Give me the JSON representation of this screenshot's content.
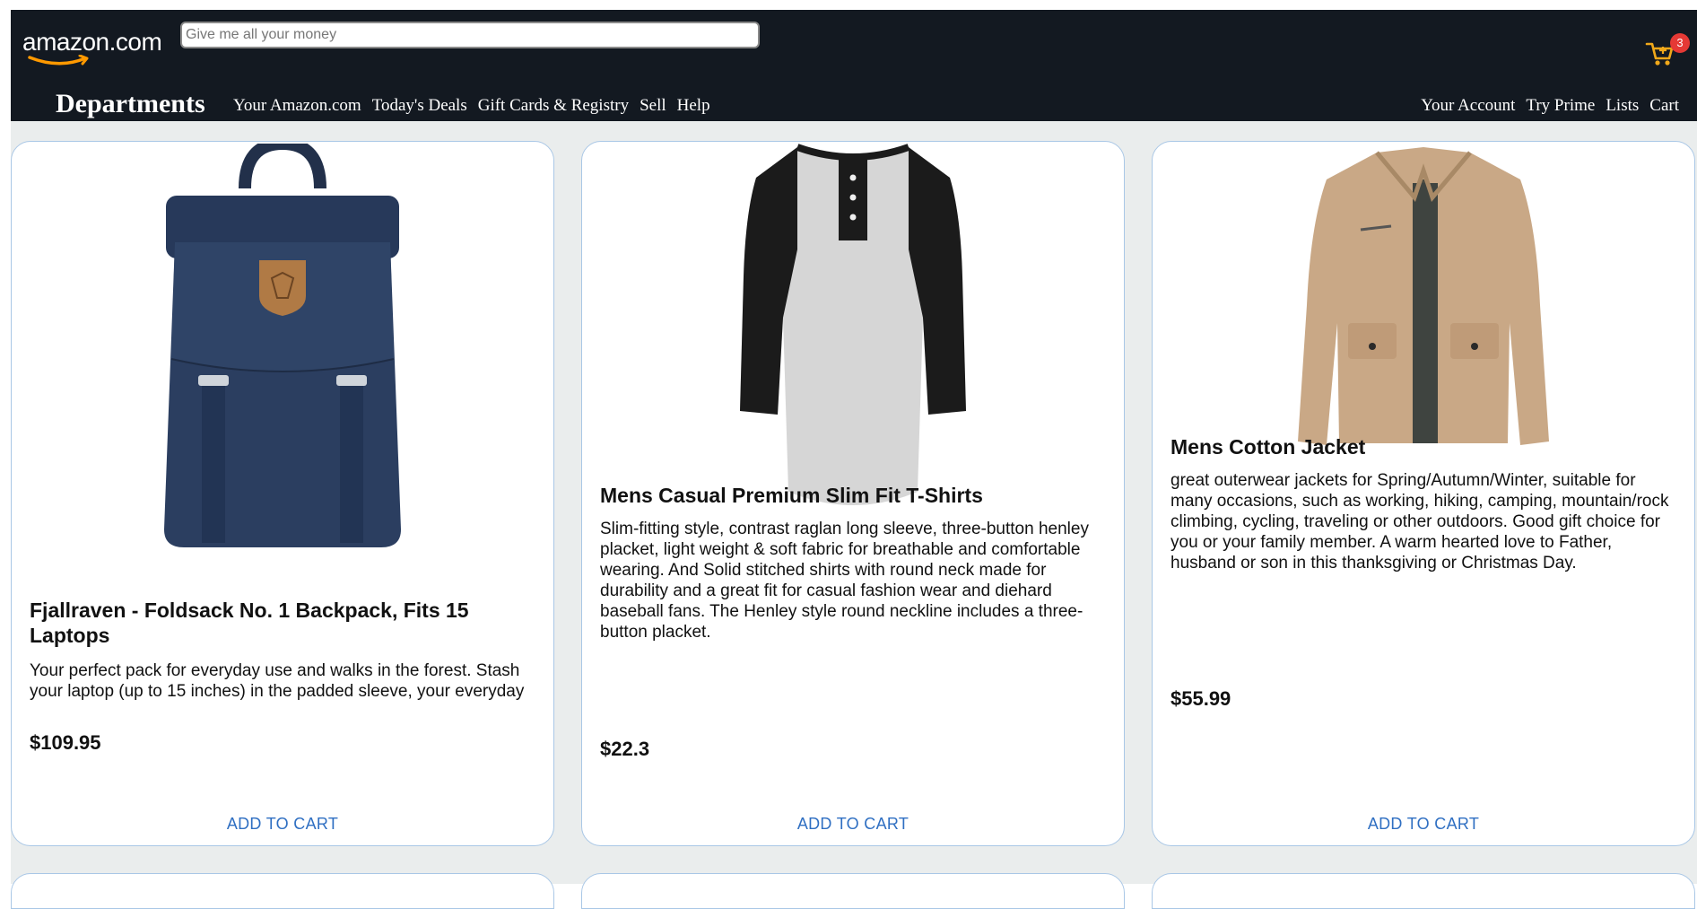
{
  "header": {
    "logo_text": "amazon.com",
    "search_placeholder": "Give me all your money",
    "cart_count": "3",
    "departments_label": "Departments",
    "nav_left": [
      "Your Amazon.com",
      "Today's Deals",
      "Gift Cards & Registry",
      "Sell",
      "Help"
    ],
    "nav_right": [
      "Your Account",
      "Try Prime",
      "Lists",
      "Cart"
    ]
  },
  "products": [
    {
      "title": "Fjallraven - Foldsack No. 1 Backpack, Fits 15 Laptops",
      "description": "Your perfect pack for everyday use and walks in the forest. Stash your laptop (up to 15 inches) in the padded sleeve, your everyday",
      "price": "$109.95",
      "button": "ADD TO CART",
      "image_icon": "backpack-icon"
    },
    {
      "title": "Mens Casual Premium Slim Fit T-Shirts",
      "description": "Slim-fitting style, contrast raglan long sleeve, three-button henley placket, light weight & soft fabric for breathable and comfortable wearing. And Solid stitched shirts with round neck made for durability and a great fit for casual fashion wear and diehard baseball fans. The Henley style round neckline includes a three-button placket.",
      "price": "$22.3",
      "button": "ADD TO CART",
      "image_icon": "tshirt-icon"
    },
    {
      "title": "Mens Cotton Jacket",
      "description": "great outerwear jackets for Spring/Autumn/Winter, suitable for many occasions, such as working, hiking, camping, mountain/rock climbing, cycling, traveling or other outdoors. Good gift choice for you or your family member. A warm hearted love to Father, husband or son in this thanksgiving or Christmas Day.",
      "price": "$55.99",
      "button": "ADD TO CART",
      "image_icon": "jacket-icon"
    }
  ],
  "colors": {
    "header_bg": "#131921",
    "link_blue": "#2f6fc2",
    "badge_red": "#e53935",
    "card_border": "#a9c7e6",
    "page_bg": "#eaeded"
  }
}
